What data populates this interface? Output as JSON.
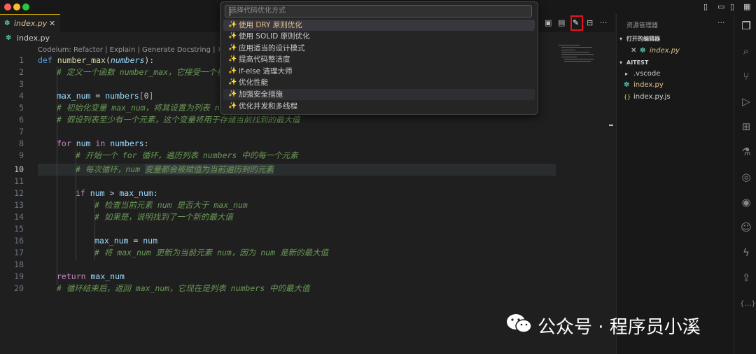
{
  "colors": {
    "accent": "#e0b600",
    "highlight": "#e81123",
    "python": "#4fc1a0"
  },
  "tab": {
    "label": "index.py",
    "close": "✕"
  },
  "breadcrumb": {
    "file": "index.py"
  },
  "codelens": "Codeium: Refactor | Explain | Generate Docstring | ✕",
  "code": {
    "lines": [
      {
        "n": "1"
      },
      {
        "n": "2"
      },
      {
        "n": "3"
      },
      {
        "n": "4"
      },
      {
        "n": "5"
      },
      {
        "n": "6"
      },
      {
        "n": "7"
      },
      {
        "n": "8"
      },
      {
        "n": "9"
      },
      {
        "n": "10"
      },
      {
        "n": "11"
      },
      {
        "n": "12"
      },
      {
        "n": "13"
      },
      {
        "n": "14"
      },
      {
        "n": "15"
      },
      {
        "n": "16"
      },
      {
        "n": "17"
      },
      {
        "n": "18"
      },
      {
        "n": "19"
      },
      {
        "n": "20"
      }
    ],
    "t": {
      "def": "def",
      "fn_name": "number_max",
      "lp": "(",
      "param": "numbers",
      "rpc": "):",
      "c2": "# 定义一个函数 number_max，它接受一个参",
      "l4a": "max_num",
      "l4b": " = ",
      "l4c": "numbers",
      "l4d": "[",
      "l4e": "0",
      "l4f": "]",
      "c5": "# 初始化变量 max_num，将其设置为列表 nu",
      "c6": "# 假设列表至少有一个元素，这个变量将用于存储当前找到的最大值",
      "for": "for",
      "num": " num ",
      "in": "in",
      "numbers": " numbers",
      ":": ":",
      "c9": "# 开始一个 for 循环，遍历列表 numbers 中的每一个元素",
      "c10a": "# 每次循环，num ",
      "c10b": "变量都会被赋值为当前遍历到的元素",
      "if": "if",
      "l12b": " num ",
      "gt": ">",
      "l12d": " max_num",
      "c13": "# 检查当前元素 num 是否大于 max_num",
      "c14": "# 如果是，说明找到了一个新的最大值",
      "l16a": "max_num",
      "l16b": " = ",
      "l16c": "num",
      "c17": "# 将 max_num 更新为当前元素 num，因为 num 是新的最大值",
      "ret": "return",
      "l19b": " max_num",
      "c20": "# 循环结束后，返回 max_num，它现在是列表 numbers 中的最大值"
    }
  },
  "palette": {
    "placeholder": "选择代码优化方式",
    "spark": "✨",
    "items": [
      {
        "label": "使用 DRY 原则优化"
      },
      {
        "label": "使用 SOLID 原则优化"
      },
      {
        "label": "应用适当的设计模式"
      },
      {
        "label": "提高代码整洁度"
      },
      {
        "label": "if-else 清理大师"
      },
      {
        "label": "优化性能"
      },
      {
        "label": "加强安全措施"
      },
      {
        "label": "优化并发和多线程"
      }
    ]
  },
  "explorer": {
    "title": "资源管理器",
    "more": "···",
    "open_editors": "打开的编辑器",
    "open_file": "index.py",
    "workspace": "AITEST",
    "items": [
      {
        "label": ".vscode",
        "icon": "▸"
      },
      {
        "label": "index.py",
        "icon": "py"
      },
      {
        "label": "index.py.js",
        "icon": "{}"
      }
    ]
  },
  "icons": {
    "explorer": "explorer-icon",
    "search": "search-icon",
    "scm": "source-control-icon",
    "debug": "run-debug-icon",
    "extensions": "extensions-icon",
    "test": "testing-icon",
    "remote": "remote-icon",
    "codeium": "codeium-icon",
    "robot": "robot-icon",
    "bolt": "bolt-icon",
    "share": "share-icon",
    "json": "json-icon"
  },
  "watermark": "公众号 · 程序员小溪"
}
